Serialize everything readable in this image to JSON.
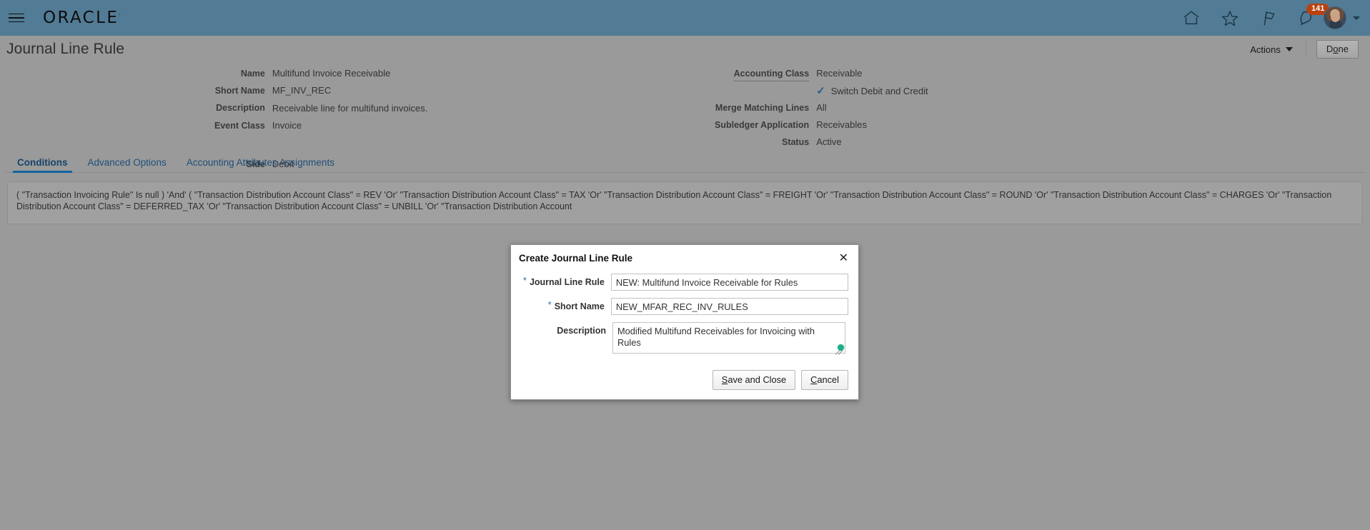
{
  "global_header": {
    "brand": "ORACLE",
    "brand_mark": "·",
    "menu_icon": "hamburger-icon",
    "icons": [
      {
        "name": "home-icon",
        "label": "Home"
      },
      {
        "name": "favorites-star-icon",
        "label": "Favorites and Recent Items"
      },
      {
        "name": "flag-icon",
        "label": "Watchlist"
      },
      {
        "name": "notifications-bell-icon",
        "label": "Notifications"
      }
    ],
    "notifications_count": "141",
    "badge_color": "#b8420f",
    "header_color": "#527b95",
    "avatar": "user-avatar"
  },
  "page": {
    "title": "Journal Line Rule",
    "actions_label": "Actions",
    "done_label": "Done",
    "done_accel": "o"
  },
  "summary": {
    "left": [
      {
        "label": "Name",
        "value": "Multifund Invoice Receivable"
      },
      {
        "label": "Short Name",
        "value": "MF_INV_REC"
      },
      {
        "label": "Description",
        "value": "Receivable line for multifund invoices."
      },
      {
        "label": "Event Class",
        "value": "Invoice"
      },
      {
        "label": "Side",
        "value": "Debit"
      }
    ],
    "right": [
      {
        "label": "Accounting Class",
        "value": "Receivable",
        "dotted": true
      },
      {
        "label": "",
        "value": "Switch Debit and Credit",
        "checkbox": true,
        "checked": true
      },
      {
        "label": "Merge Matching Lines",
        "value": "All"
      },
      {
        "label": "Subledger Application",
        "value": "Receivables"
      },
      {
        "label": "Status",
        "value": "Active"
      }
    ]
  },
  "tabs": [
    {
      "label": "Conditions",
      "active": true
    },
    {
      "label": "Advanced Options",
      "active": false
    },
    {
      "label": "Accounting Attributes Assignments",
      "active": false
    }
  ],
  "conditions": {
    "expression": "( \"Transaction Invoicing Rule\" Is null ) 'And' ( \"Transaction Distribution Account Class\" = REV 'Or' \"Transaction Distribution Account Class\" = TAX 'Or' \"Transaction Distribution Account Class\" = FREIGHT 'Or' \"Transaction Distribution Account Class\" = ROUND 'Or' \"Transaction Distribution Account Class\" = CHARGES 'Or' \"Transaction Distribution Account Class\" = DEFERRED_TAX 'Or' \"Transaction Distribution Account Class\" = UNBILL 'Or' \"Transaction Distribution Account"
  },
  "dialog": {
    "title": "Create Journal Line Rule",
    "close_icon": "✕",
    "fields": [
      {
        "label": "Journal Line Rule",
        "required": true,
        "value": "NEW: Multifund Invoice Receivable for Rules",
        "placeholder": ""
      },
      {
        "label": "Short Name",
        "required": true,
        "value": "NEW_MFAR_REC_INV_RULES",
        "placeholder": ""
      },
      {
        "label": "Description",
        "required": false,
        "value": "Modified Multifund Receivables for Invoicing with Rules",
        "placeholder": ""
      }
    ],
    "buttons": [
      {
        "label": "Save and Close",
        "accel": "S"
      },
      {
        "label": "Cancel",
        "accel": "C"
      }
    ],
    "cursor_indicator_color": "#16b08a"
  }
}
